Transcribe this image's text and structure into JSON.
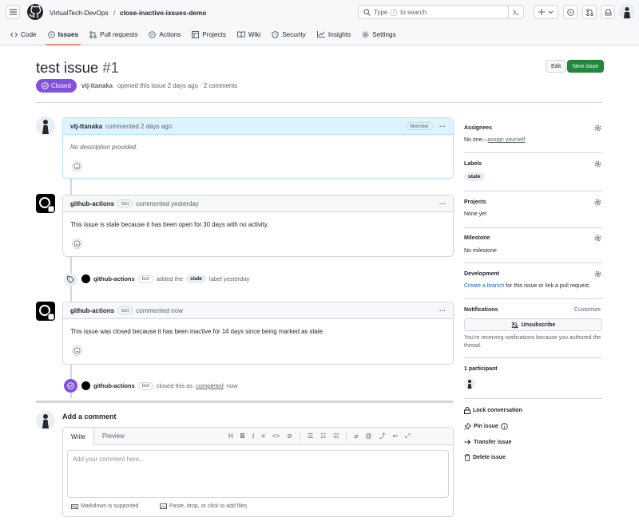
{
  "header": {
    "owner": "VirtualTech-DevOps",
    "separator": "/",
    "repo": "close-inactive-issues-demo",
    "search_prefix": "Type",
    "search_key": "/",
    "search_suffix": "to search"
  },
  "tabs": [
    {
      "label": "Code"
    },
    {
      "label": "Issues"
    },
    {
      "label": "Pull requests"
    },
    {
      "label": "Actions"
    },
    {
      "label": "Projects"
    },
    {
      "label": "Wiki"
    },
    {
      "label": "Security"
    },
    {
      "label": "Insights"
    },
    {
      "label": "Settings"
    }
  ],
  "issue": {
    "title": "test issue",
    "number": "#1",
    "state": "Closed",
    "author": "vtj-ttanaka",
    "meta": "opened this issue 2 days ago · 2 comments",
    "edit_label": "Edit",
    "new_label": "New issue"
  },
  "comments": [
    {
      "author": "vtj-ttanaka",
      "action": "commented 2 days ago",
      "badge": "Member",
      "body": "No description provided."
    },
    {
      "author": "github-actions",
      "bot": "bot",
      "action": "commented yesterday",
      "body": "This issue is stale because it has been open for 30 days with no activity."
    },
    {
      "author": "github-actions",
      "bot": "bot",
      "action": "commented now",
      "body": "This issue was closed because it has been inactive for 14 days since being marked as stale."
    }
  ],
  "events": [
    {
      "actor": "github-actions",
      "bot": "bot",
      "pre": "added the",
      "label": "stale",
      "post": "label yesterday"
    },
    {
      "actor": "github-actions",
      "bot": "bot",
      "pre": "closed this as",
      "link": "completed",
      "post": "now"
    }
  ],
  "composer": {
    "heading": "Add a comment",
    "tab_write": "Write",
    "tab_preview": "Preview",
    "placeholder": "Add your comment here...",
    "markdown": "Markdown is supported",
    "attach": "Paste, drop, or click to add files"
  },
  "sidebar": {
    "assignees": {
      "title": "Assignees",
      "value": "No one—",
      "link": "assign yourself"
    },
    "labels": {
      "title": "Labels",
      "value": "stale"
    },
    "projects": {
      "title": "Projects",
      "value": "None yet"
    },
    "milestone": {
      "title": "Milestone",
      "value": "No milestone"
    },
    "development": {
      "title": "Development",
      "link": "Create a branch",
      "value": "for this issue or link a pull request."
    },
    "notifications": {
      "title": "Notifications",
      "customize": "Customize",
      "button": "Unsubscribe",
      "note": "You're receiving notifications because you authored the thread."
    },
    "participants": {
      "title": "1 participant"
    },
    "actions": [
      {
        "label": "Lock conversation",
        "icon": "lock-icon"
      },
      {
        "label": "Pin issue",
        "icon": "pin-icon"
      },
      {
        "label": "Transfer issue",
        "icon": "arrow-right-icon"
      },
      {
        "label": "Delete issue",
        "icon": "trash-icon"
      }
    ]
  },
  "colors": {
    "accent": "#0969da",
    "closed": "#8250df",
    "primary": "#1f883d",
    "tab_underline": "#fd8c73"
  }
}
